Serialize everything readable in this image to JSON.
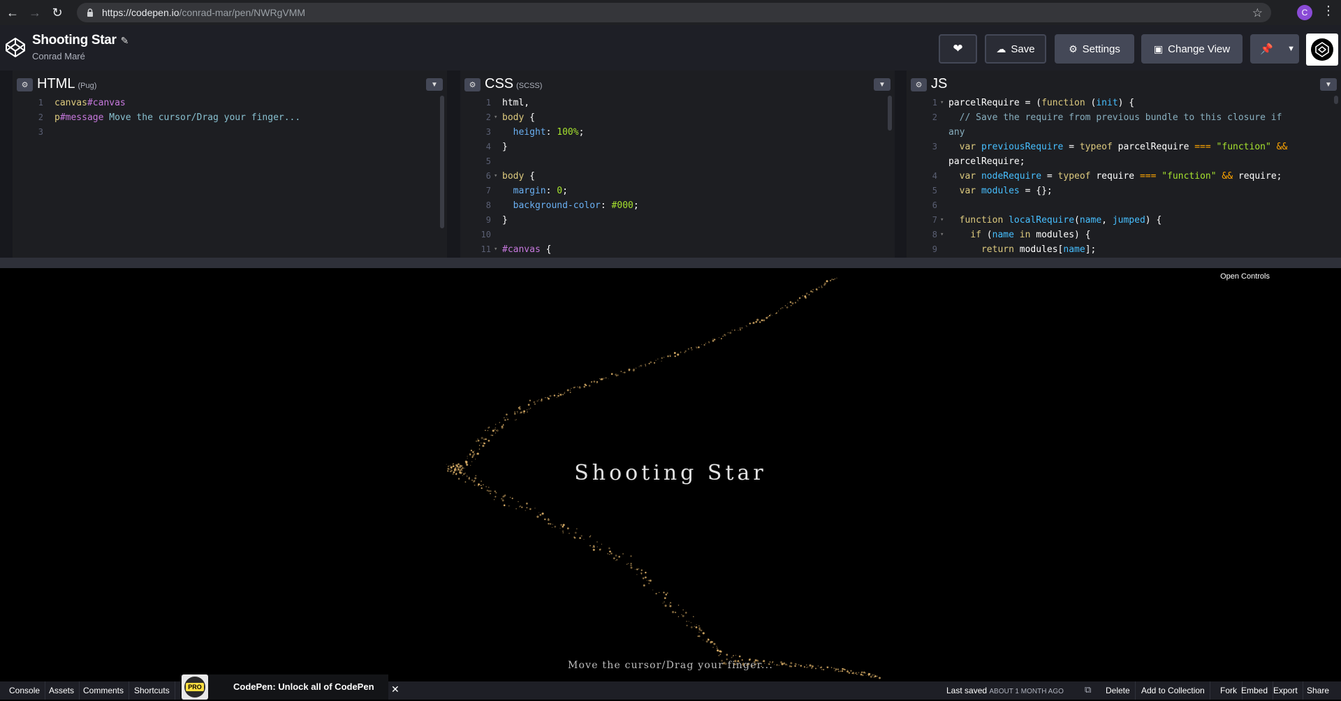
{
  "browser": {
    "url_host": "https://codepen.io",
    "url_path": "/conrad-mar/pen/NWRgVMM",
    "profile_initial": "C"
  },
  "header": {
    "pen_title": "Shooting Star",
    "author": "Conrad Maré",
    "save_label": "Save",
    "settings_label": "Settings",
    "change_view_label": "Change View"
  },
  "panes": {
    "html": {
      "name": "HTML",
      "preprocessor": "(Pug)",
      "lines": [
        {
          "n": "1",
          "parts": [
            [
              "k",
              "canvas"
            ],
            [
              "id",
              "#canvas"
            ]
          ]
        },
        {
          "n": "2",
          "parts": [
            [
              "k",
              "p"
            ],
            [
              "id",
              "#message"
            ],
            [
              "t",
              " Move the cursor/Drag your finger..."
            ]
          ]
        },
        {
          "n": "3",
          "parts": []
        }
      ]
    },
    "css": {
      "name": "CSS",
      "preprocessor": "(SCSS)",
      "lines": [
        {
          "n": "1",
          "parts": [
            [
              "txt",
              "html,"
            ]
          ]
        },
        {
          "n": "2",
          "fold": true,
          "parts": [
            [
              "k",
              "body"
            ],
            [
              "txt",
              " {"
            ]
          ]
        },
        {
          "n": "3",
          "parts": [
            [
              "txt",
              "  "
            ],
            [
              "pr",
              "height"
            ],
            [
              "txt",
              ": "
            ],
            [
              "num",
              "100%"
            ],
            [
              "txt",
              ";"
            ]
          ]
        },
        {
          "n": "4",
          "parts": [
            [
              "txt",
              "}"
            ]
          ]
        },
        {
          "n": "5",
          "parts": []
        },
        {
          "n": "6",
          "fold": true,
          "parts": [
            [
              "k",
              "body"
            ],
            [
              "txt",
              " {"
            ]
          ]
        },
        {
          "n": "7",
          "parts": [
            [
              "txt",
              "  "
            ],
            [
              "pr",
              "margin"
            ],
            [
              "txt",
              ": "
            ],
            [
              "num",
              "0"
            ],
            [
              "txt",
              ";"
            ]
          ]
        },
        {
          "n": "8",
          "parts": [
            [
              "txt",
              "  "
            ],
            [
              "pr",
              "background-color"
            ],
            [
              "txt",
              ": "
            ],
            [
              "num",
              "#000"
            ],
            [
              "txt",
              ";"
            ]
          ]
        },
        {
          "n": "9",
          "parts": [
            [
              "txt",
              "}"
            ]
          ]
        },
        {
          "n": "10",
          "parts": []
        },
        {
          "n": "11",
          "fold": true,
          "parts": [
            [
              "id",
              "#canvas"
            ],
            [
              "txt",
              " {"
            ]
          ]
        }
      ]
    },
    "js": {
      "name": "JS",
      "lines": [
        {
          "n": "1",
          "fold": true,
          "parts": [
            [
              "txt",
              "parcelRequire = ("
            ],
            [
              "kw",
              "function"
            ],
            [
              "txt",
              " ("
            ],
            [
              "var",
              "init"
            ],
            [
              "txt",
              ") {"
            ]
          ]
        },
        {
          "n": "2",
          "parts": [
            [
              "cm",
              "  // Save the require from previous bundle to this closure if"
            ]
          ]
        },
        {
          "n": "",
          "parts": [
            [
              "cm",
              "any"
            ]
          ]
        },
        {
          "n": "3",
          "parts": [
            [
              "txt",
              "  "
            ],
            [
              "kw",
              "var"
            ],
            [
              "txt",
              " "
            ],
            [
              "var",
              "previousRequire"
            ],
            [
              "txt",
              " = "
            ],
            [
              "kw",
              "typeof"
            ],
            [
              "txt",
              " parcelRequire "
            ],
            [
              "op",
              "==="
            ],
            [
              "txt",
              " "
            ],
            [
              "str",
              "\"function\""
            ],
            [
              "txt",
              " "
            ],
            [
              "op",
              "&&"
            ]
          ]
        },
        {
          "n": "",
          "parts": [
            [
              "txt",
              "parcelRequire;"
            ]
          ]
        },
        {
          "n": "4",
          "parts": [
            [
              "txt",
              "  "
            ],
            [
              "kw",
              "var"
            ],
            [
              "txt",
              " "
            ],
            [
              "var",
              "nodeRequire"
            ],
            [
              "txt",
              " = "
            ],
            [
              "kw",
              "typeof"
            ],
            [
              "txt",
              " require "
            ],
            [
              "op",
              "==="
            ],
            [
              "txt",
              " "
            ],
            [
              "str",
              "\"function\""
            ],
            [
              "txt",
              " "
            ],
            [
              "op",
              "&&"
            ],
            [
              "txt",
              " require;"
            ]
          ]
        },
        {
          "n": "5",
          "parts": [
            [
              "txt",
              "  "
            ],
            [
              "kw",
              "var"
            ],
            [
              "txt",
              " "
            ],
            [
              "var",
              "modules"
            ],
            [
              "txt",
              " = {};"
            ]
          ]
        },
        {
          "n": "6",
          "parts": []
        },
        {
          "n": "7",
          "fold": true,
          "parts": [
            [
              "txt",
              "  "
            ],
            [
              "kw",
              "function"
            ],
            [
              "txt",
              " "
            ],
            [
              "fn",
              "localRequire"
            ],
            [
              "txt",
              "("
            ],
            [
              "var",
              "name"
            ],
            [
              "txt",
              ", "
            ],
            [
              "var",
              "jumped"
            ],
            [
              "txt",
              ") {"
            ]
          ]
        },
        {
          "n": "8",
          "fold": true,
          "parts": [
            [
              "txt",
              "    "
            ],
            [
              "kw",
              "if"
            ],
            [
              "txt",
              " ("
            ],
            [
              "var",
              "name"
            ],
            [
              "txt",
              " "
            ],
            [
              "kw",
              "in"
            ],
            [
              "txt",
              " modules) {"
            ]
          ]
        },
        {
          "n": "9",
          "parts": [
            [
              "txt",
              "      "
            ],
            [
              "kw",
              "return"
            ],
            [
              "txt",
              " modules["
            ],
            [
              "var",
              "name"
            ],
            [
              "txt",
              "];"
            ]
          ]
        }
      ]
    }
  },
  "preview": {
    "open_controls": "Open Controls",
    "title": "Shooting Star",
    "message": "Move the cursor/Drag your finger..."
  },
  "footer": {
    "console": "Console",
    "assets": "Assets",
    "comments": "Comments",
    "shortcuts": "Shortcuts",
    "pro_badge": "PRO",
    "promo": "CodePen: Unlock all of CodePen",
    "last_saved": "Last saved",
    "saved_ago": "ABOUT 1 MONTH AGO",
    "delete": "Delete",
    "add_to_collection": "Add to Collection",
    "fork": "Fork",
    "embed": "Embed",
    "export": "Export",
    "share": "Share"
  },
  "colors": {
    "header_bg": "#1e1f26",
    "button_bg": "#444857",
    "pane_bg": "#1d1e22",
    "trail": "#e0b36a"
  }
}
